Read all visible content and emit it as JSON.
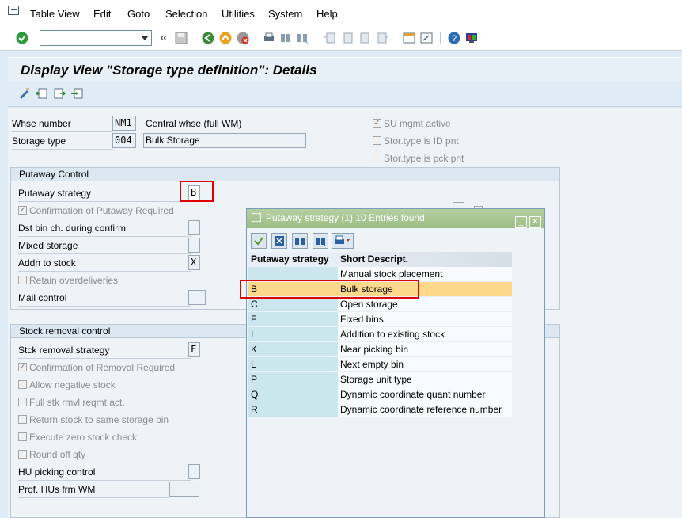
{
  "menu": {
    "items": [
      {
        "label": "Table View",
        "key": "T"
      },
      {
        "label": "Edit",
        "key": "E"
      },
      {
        "label": "Goto",
        "key": "G"
      },
      {
        "label": "Selection",
        "key": "S"
      },
      {
        "label": "Utilities",
        "key": "U"
      },
      {
        "label": "System",
        "key": "y"
      },
      {
        "label": "Help",
        "key": "H"
      }
    ]
  },
  "toolbar": {
    "command_field_value": "",
    "back_glyph": "«"
  },
  "title": "Display View \"Storage type definition\": Details",
  "header": {
    "whse_label": "Whse number",
    "whse_value": "NM1",
    "whse_desc": "Central whse (full WM)",
    "stype_label": "Storage type",
    "stype_value": "004",
    "stype_desc": "Bulk Storage",
    "su_mgmt_label": "SU mgmt active",
    "id_pnt_label": "Stor.type is ID pnt",
    "pck_pnt_label": "Stor.type is pck pnt"
  },
  "putaway": {
    "title": "Putaway Control",
    "strategy_label": "Putaway strategy",
    "strategy_value": "B",
    "confirm_label": "Confirmation of Putaway Required",
    "dst_bin_label": "Dst bin ch. during confirm",
    "mixed_label": "Mixed storage",
    "addn_label": "Addn to stock",
    "addn_value": "X",
    "retain_label": "Retain overdeliveries",
    "mail_label": "Mail control"
  },
  "removal": {
    "title": "Stock removal control",
    "strategy_label": "Stck removal strategy",
    "strategy_value": "F",
    "confirm_label": "Confirmation of Removal Required",
    "negative_label": "Allow negative stock",
    "full_stk_label": "Full stk rmvl reqmt act.",
    "return_label": "Return stock to same storage bin",
    "zero_label": "Execute zero stock check",
    "round_label": "Round off qty",
    "hu_label": "HU picking control",
    "prof_label": "Prof. HUs frm WM"
  },
  "popup": {
    "title": "Putaway strategy (1)   10 Entries found",
    "col1": "Putaway strategy",
    "col2": "Short Descript.",
    "rows": [
      {
        "code": "",
        "desc": "Manual stock placement"
      },
      {
        "code": "B",
        "desc": "Bulk storage"
      },
      {
        "code": "C",
        "desc": "Open storage"
      },
      {
        "code": "F",
        "desc": "Fixed bins"
      },
      {
        "code": "I",
        "desc": "Addition to existing stock"
      },
      {
        "code": "K",
        "desc": "Near picking bin"
      },
      {
        "code": "L",
        "desc": "Next empty bin"
      },
      {
        "code": "P",
        "desc": "Storage unit type"
      },
      {
        "code": "Q",
        "desc": "Dynamic coordinate quant number"
      },
      {
        "code": "R",
        "desc": "Dynamic coordinate reference number"
      }
    ],
    "selected_index": 1
  }
}
